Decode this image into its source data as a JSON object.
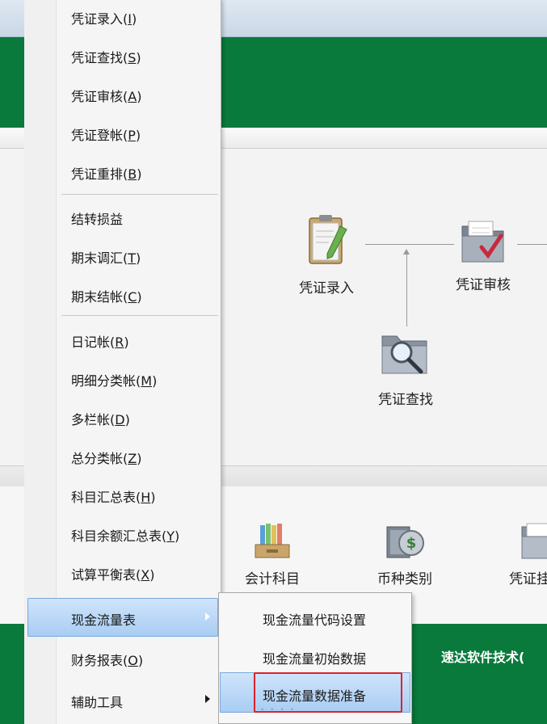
{
  "menu": {
    "items": [
      {
        "label": "凭证录入(",
        "hotkey": "I",
        "tail": ")"
      },
      {
        "label": "凭证查找(",
        "hotkey": "S",
        "tail": ")"
      },
      {
        "label": "凭证审核(",
        "hotkey": "A",
        "tail": ")"
      },
      {
        "label": "凭证登帐(",
        "hotkey": "P",
        "tail": ")"
      },
      {
        "label": "凭证重排(",
        "hotkey": "B",
        "tail": ")"
      },
      {
        "label": "结转损益",
        "hotkey": "",
        "tail": ""
      },
      {
        "label": "期末调汇(",
        "hotkey": "T",
        "tail": ")"
      },
      {
        "label": "期末结帐(",
        "hotkey": "C",
        "tail": ")"
      },
      {
        "label": "日记帐(",
        "hotkey": "R",
        "tail": ")"
      },
      {
        "label": "明细分类帐(",
        "hotkey": "M",
        "tail": ")"
      },
      {
        "label": "多栏帐(",
        "hotkey": "D",
        "tail": ")"
      },
      {
        "label": "总分类帐(",
        "hotkey": "Z",
        "tail": ")"
      },
      {
        "label": "科目汇总表(",
        "hotkey": "H",
        "tail": ")"
      },
      {
        "label": "科目余额汇总表(",
        "hotkey": "Y",
        "tail": ")"
      },
      {
        "label": "试算平衡表(",
        "hotkey": "X",
        "tail": ")"
      },
      {
        "label": "现金流量表",
        "hotkey": "",
        "tail": ""
      },
      {
        "label": "财务报表(",
        "hotkey": "O",
        "tail": ")"
      },
      {
        "label": "辅助工具",
        "hotkey": "",
        "tail": ""
      }
    ]
  },
  "submenu": {
    "items": [
      {
        "label": "现金流量代码设置"
      },
      {
        "label": "现金流量初始数据"
      },
      {
        "label": "现金流量数据准备"
      }
    ]
  },
  "flow": {
    "voucher_entry": "凭证录入",
    "voucher_audit": "凭证审核",
    "voucher_search": "凭证查找"
  },
  "toolbar": {
    "accounts": "会计科目",
    "currency": "币种类别",
    "voucher_partial": "凭证挂"
  },
  "footer": {
    "company": "速达软件技术("
  },
  "colors": {
    "banner_green": "#0a7a3c",
    "highlight_blue": "#a9cdf3",
    "focus_red": "#d9232e"
  }
}
